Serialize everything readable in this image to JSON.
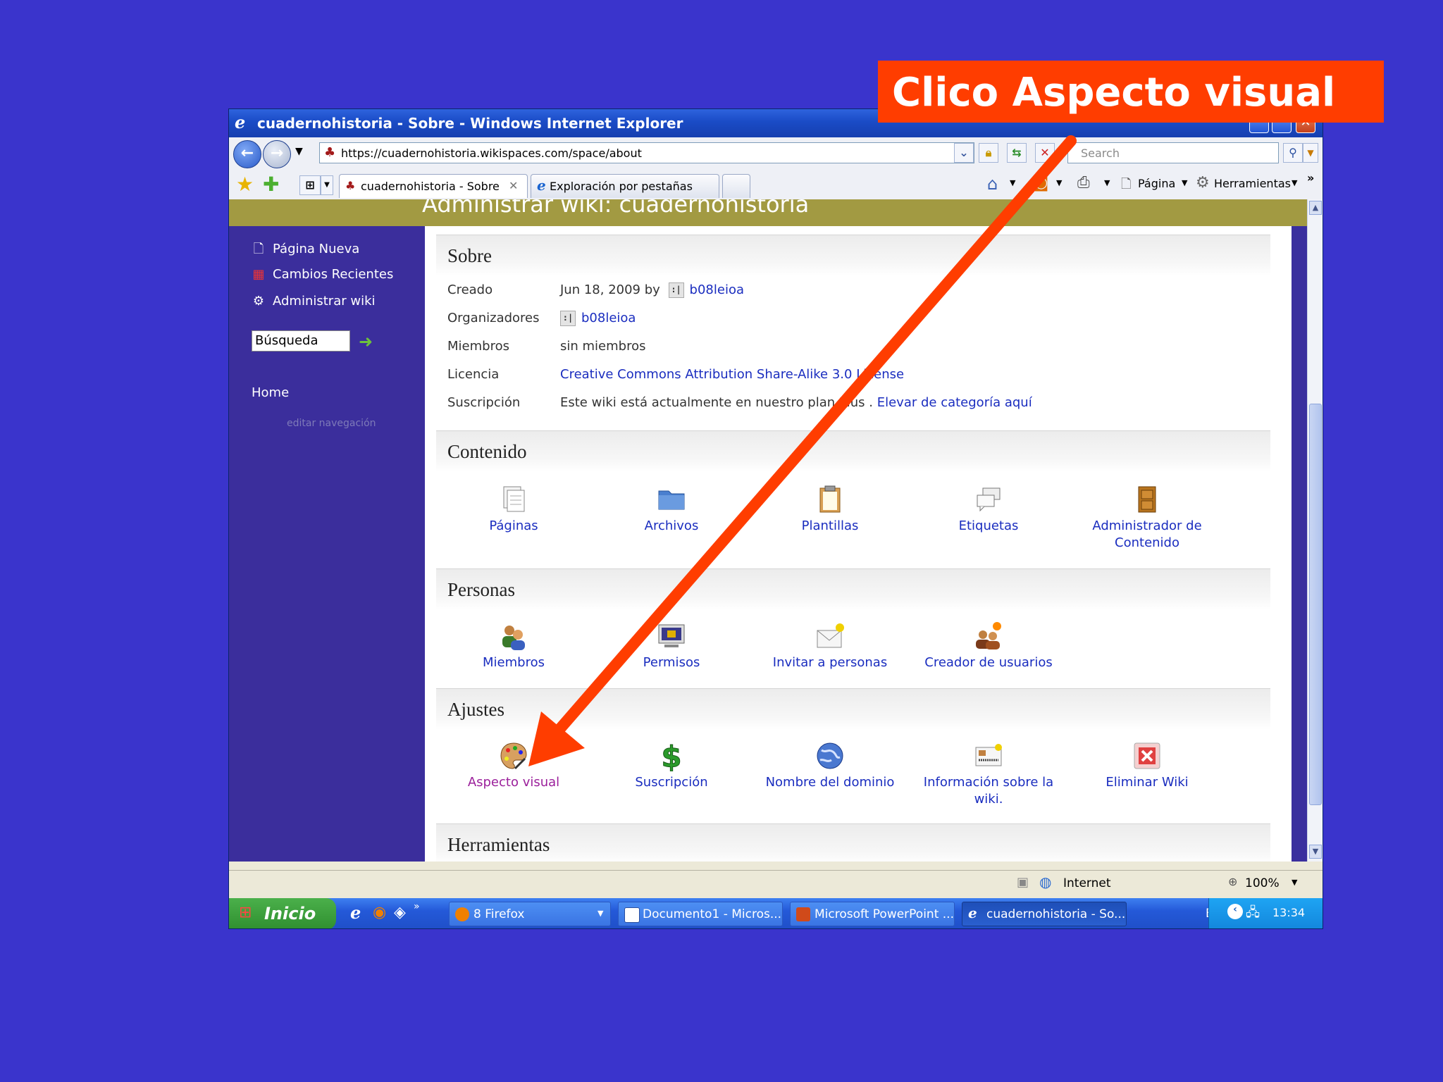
{
  "callout": {
    "text": "Clico Aspecto visual"
  },
  "window": {
    "title": "cuadernohistoria - Sobre - Windows Internet Explorer"
  },
  "address": {
    "url": "https://cuadernohistoria.wikispaces.com/space/about",
    "search_placeholder": "Search"
  },
  "tabs": [
    {
      "label": "cuadernohistoria - Sobre"
    },
    {
      "label": "Exploración por pestañas"
    }
  ],
  "command_bar": {
    "page": "Página",
    "tools": "Herramientas"
  },
  "banner": {
    "text": "Administrar wiki: cuadernohistoria"
  },
  "sidebar": {
    "items": [
      {
        "label": "Página Nueva"
      },
      {
        "label": "Cambios Recientes"
      },
      {
        "label": "Administrar wiki"
      }
    ],
    "search_value": "Búsqueda",
    "home": "Home",
    "edit_nav": "editar navegación"
  },
  "about": {
    "heading": "Sobre",
    "rows": [
      {
        "label": "Creado",
        "date": "Jun 18, 2009 by",
        "user": "b08leioa"
      },
      {
        "label": "Organizadores",
        "user": "b08leioa"
      },
      {
        "label": "Miembros",
        "value": "sin miembros"
      },
      {
        "label": "Licencia",
        "value": "Creative Commons Attribution Share-Alike 3.0 License"
      },
      {
        "label": "Suscripción",
        "value": "Este wiki está actualmente en nuestro plan Plus .",
        "link": "Elevar de categoría aquí"
      }
    ]
  },
  "content": {
    "heading": "Contenido",
    "items": [
      {
        "label": "Páginas"
      },
      {
        "label": "Archivos"
      },
      {
        "label": "Plantillas"
      },
      {
        "label": "Etiquetas"
      },
      {
        "label": "Administrador de Contenido"
      }
    ]
  },
  "people": {
    "heading": "Personas",
    "items": [
      {
        "label": "Miembros"
      },
      {
        "label": "Permisos"
      },
      {
        "label": "Invitar a personas"
      },
      {
        "label": "Creador de usuarios"
      }
    ]
  },
  "settings": {
    "heading": "Ajustes",
    "items": [
      {
        "label": "Aspecto visual"
      },
      {
        "label": "Suscripción"
      },
      {
        "label": "Nombre del dominio"
      },
      {
        "label": "Información sobre la wiki."
      },
      {
        "label": "Eliminar Wiki"
      }
    ]
  },
  "tools": {
    "heading": "Herramientas"
  },
  "status": {
    "zone": "Internet",
    "zoom": "100%"
  },
  "taskbar": {
    "start": "Inicio",
    "tasks": [
      {
        "label": "8 Firefox"
      },
      {
        "label": "Documento1 - Micros..."
      },
      {
        "label": "Microsoft PowerPoint ..."
      },
      {
        "label": "cuadernohistoria - So..."
      }
    ],
    "lang": "ES",
    "time": "13:34"
  },
  "colors": {
    "desktop": "#3a34cc",
    "callout": "#ff3d00",
    "link": "#1a2dbf",
    "visited": "#9b1f9b"
  }
}
